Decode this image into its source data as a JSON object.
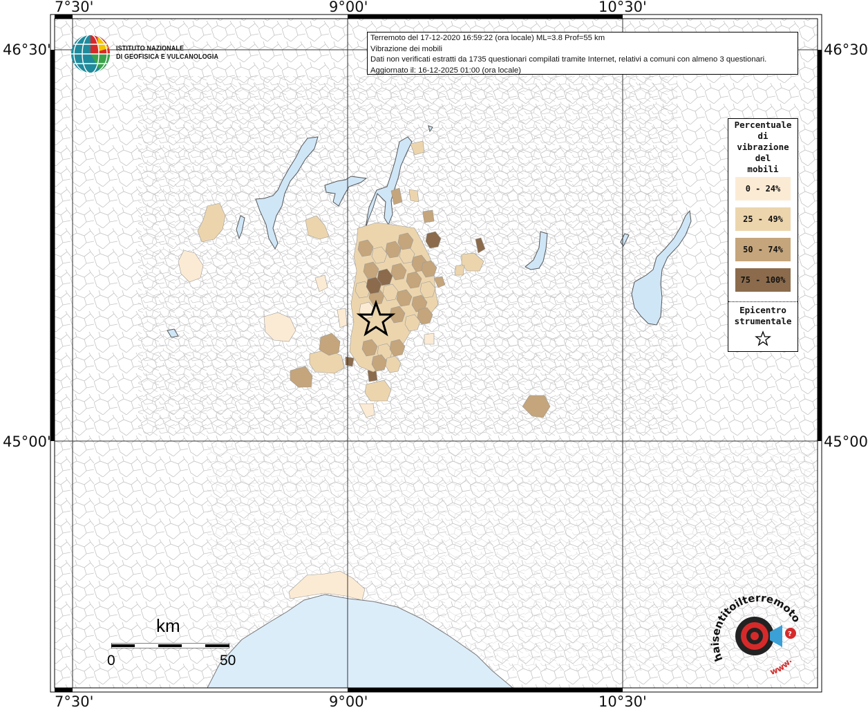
{
  "coords": {
    "top": [
      "7°30'",
      "9°00'",
      "10°30'"
    ],
    "bottom": [
      "7°30'",
      "9°00'",
      "10°30'"
    ],
    "left": [
      "46°30'",
      "45°00'"
    ],
    "right": [
      "46°30'",
      "45°00'"
    ]
  },
  "ingv": {
    "line1": "ISTITUTO NAZIONALE",
    "line2": "DI GEOFISICA E VULCANOLOGIA"
  },
  "info": {
    "line1": "Terremoto del 17-12-2020 16:59:22 (ora locale) ML=3.8 Prof=55 km",
    "line2": "Vibrazione dei mobili",
    "line3": "Dati non verificati estratti da 1735 questionari compilati tramite Internet, relativi a comuni con almeno 3 questionari.",
    "line4": "Aggiornato il: 16-12-2025 01:00 (ora locale)"
  },
  "legend": {
    "title": "Percentuale\ndi\nvibrazione\ndel\n mobili",
    "items": [
      {
        "label": "0 - 24%",
        "color": "#fcebd4"
      },
      {
        "label": "25 - 49%",
        "color": "#ecd5ad"
      },
      {
        "label": "50 - 74%",
        "color": "#c5a57b"
      },
      {
        "label": "75 - 100%",
        "color": "#8b6b4c"
      }
    ],
    "epicenter": "Epicentro\nstrumentale"
  },
  "scale": {
    "unit": "km",
    "min": "0",
    "max": "50"
  },
  "haisentito": {
    "text": "haisentitoilterremoto.it",
    "www": "www."
  },
  "colors": {
    "sea": "#dcedfa",
    "lake": "#cfe6f7",
    "borders": "#b4b4b4",
    "grid": "#333333"
  }
}
